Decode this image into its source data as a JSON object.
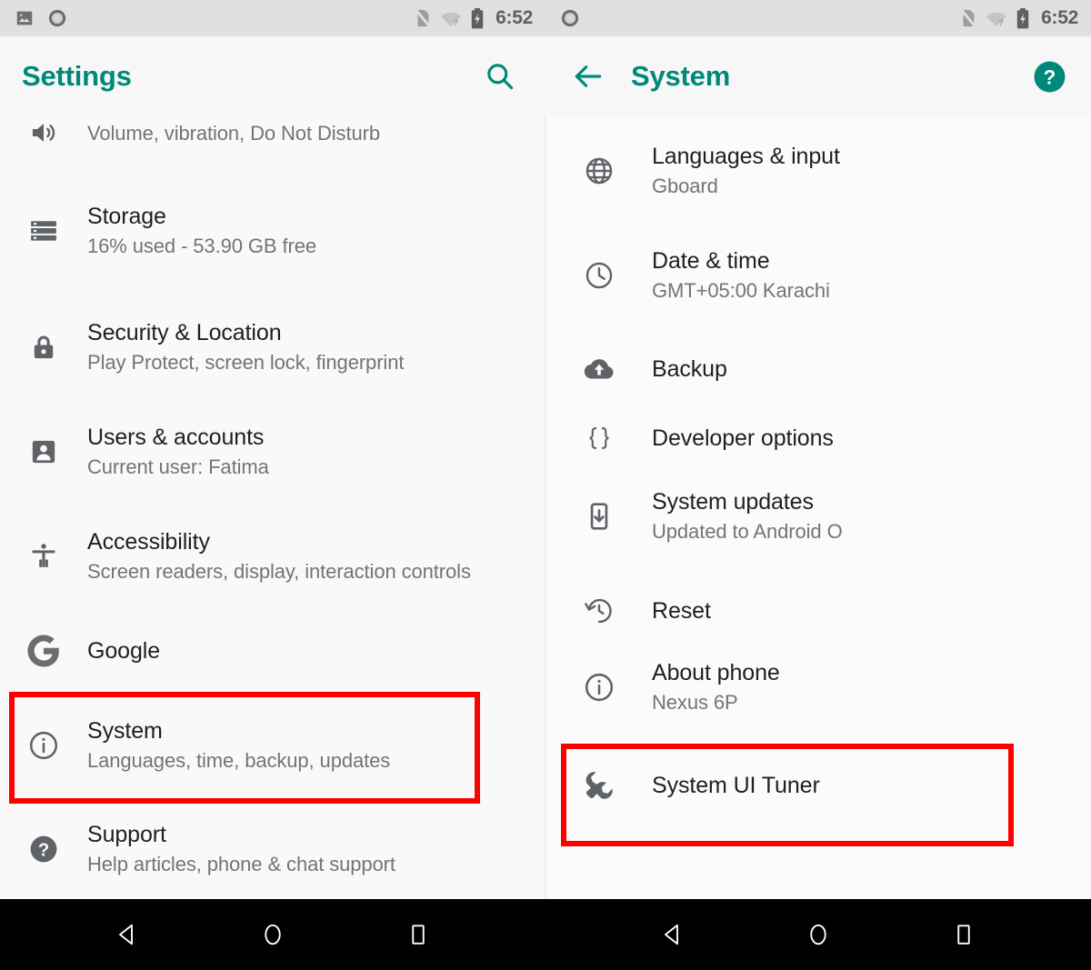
{
  "status_bar": {
    "time": "6:52",
    "left_icons": [
      "image-icon",
      "record-circle-icon"
    ],
    "right_icons": [
      "no-sim-icon",
      "wifi-unknown-icon",
      "battery-charging-icon"
    ]
  },
  "left_panel": {
    "title": "Settings",
    "search_label": "search-icon",
    "items": [
      {
        "icon": "volume-icon",
        "title": "",
        "subtitle": "Volume, vibration, Do Not Disturb"
      },
      {
        "icon": "storage-icon",
        "title": "Storage",
        "subtitle": "16% used - 53.90 GB free"
      },
      {
        "icon": "lock-icon",
        "title": "Security & Location",
        "subtitle": "Play Protect, screen lock, fingerprint"
      },
      {
        "icon": "account-icon",
        "title": "Users & accounts",
        "subtitle": "Current user: Fatima"
      },
      {
        "icon": "accessibility-icon",
        "title": "Accessibility",
        "subtitle": "Screen readers, display, interaction controls"
      },
      {
        "icon": "google-icon",
        "title": "Google",
        "subtitle": ""
      },
      {
        "icon": "info-icon",
        "title": "System",
        "subtitle": "Languages, time, backup, updates"
      },
      {
        "icon": "help-circle-icon",
        "title": "Support",
        "subtitle": "Help articles, phone & chat support"
      }
    ]
  },
  "right_panel": {
    "title": "System",
    "back_label": "back-arrow-icon",
    "help_label": "help-icon",
    "items": [
      {
        "icon": "globe-icon",
        "title": "Languages & input",
        "subtitle": "Gboard"
      },
      {
        "icon": "clock-icon",
        "title": "Date & time",
        "subtitle": "GMT+05:00 Karachi"
      },
      {
        "icon": "cloud-upload-icon",
        "title": "Backup",
        "subtitle": ""
      },
      {
        "icon": "braces-icon",
        "title": "Developer options",
        "subtitle": ""
      },
      {
        "icon": "phone-update-icon",
        "title": "System updates",
        "subtitle": "Updated to Android O"
      },
      {
        "icon": "restore-icon",
        "title": "Reset",
        "subtitle": ""
      },
      {
        "icon": "info-icon",
        "title": "About phone",
        "subtitle": "Nexus 6P"
      },
      {
        "icon": "wrench-icon",
        "title": "System UI Tuner",
        "subtitle": ""
      }
    ]
  },
  "annotations": {
    "highlight_color": "#ff0000",
    "boxes": [
      {
        "target": "System"
      },
      {
        "target": "System UI Tuner"
      }
    ]
  },
  "nav_bar": {
    "buttons": [
      "back-triangle-icon",
      "home-circle-icon",
      "recents-square-icon"
    ]
  },
  "colors": {
    "accent": "#00897b",
    "status_bar_bg": "#e0e0e0",
    "app_bar_bg": "#f7f7f7",
    "panel_bg": "#fafafa",
    "nav_bar_bg": "#000000"
  }
}
